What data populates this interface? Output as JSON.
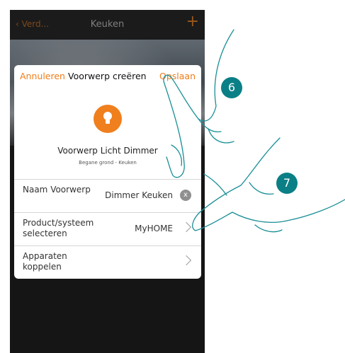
{
  "navbar": {
    "back_label": "Verd...",
    "title": "Keuken",
    "add_label": "+"
  },
  "dialog": {
    "cancel_label": "Annuleren",
    "title": "Voorwerp creëren",
    "save_label": "Opslaan",
    "object_icon": "light-bulb-icon",
    "object_name": "Voorwerp Licht Dimmer",
    "object_location": "Begane grond - Keuken",
    "rows": [
      {
        "label": "Naam Voorwerp",
        "value": "Dimmer Keuken",
        "action_icon": "clear-icon",
        "action_glyph": "x"
      },
      {
        "label": "Product/systeem selecteren",
        "value": "MyHOME",
        "action_icon": "chevron-right-icon"
      },
      {
        "label": "Apparaten koppelen",
        "value": "",
        "action_icon": "chevron-right-icon"
      }
    ]
  },
  "annotations": {
    "step_a": "6",
    "step_b": "7"
  },
  "colors": {
    "accent": "#ef7d1a",
    "badge": "#0b7f86",
    "phone_bg": "#151515"
  }
}
